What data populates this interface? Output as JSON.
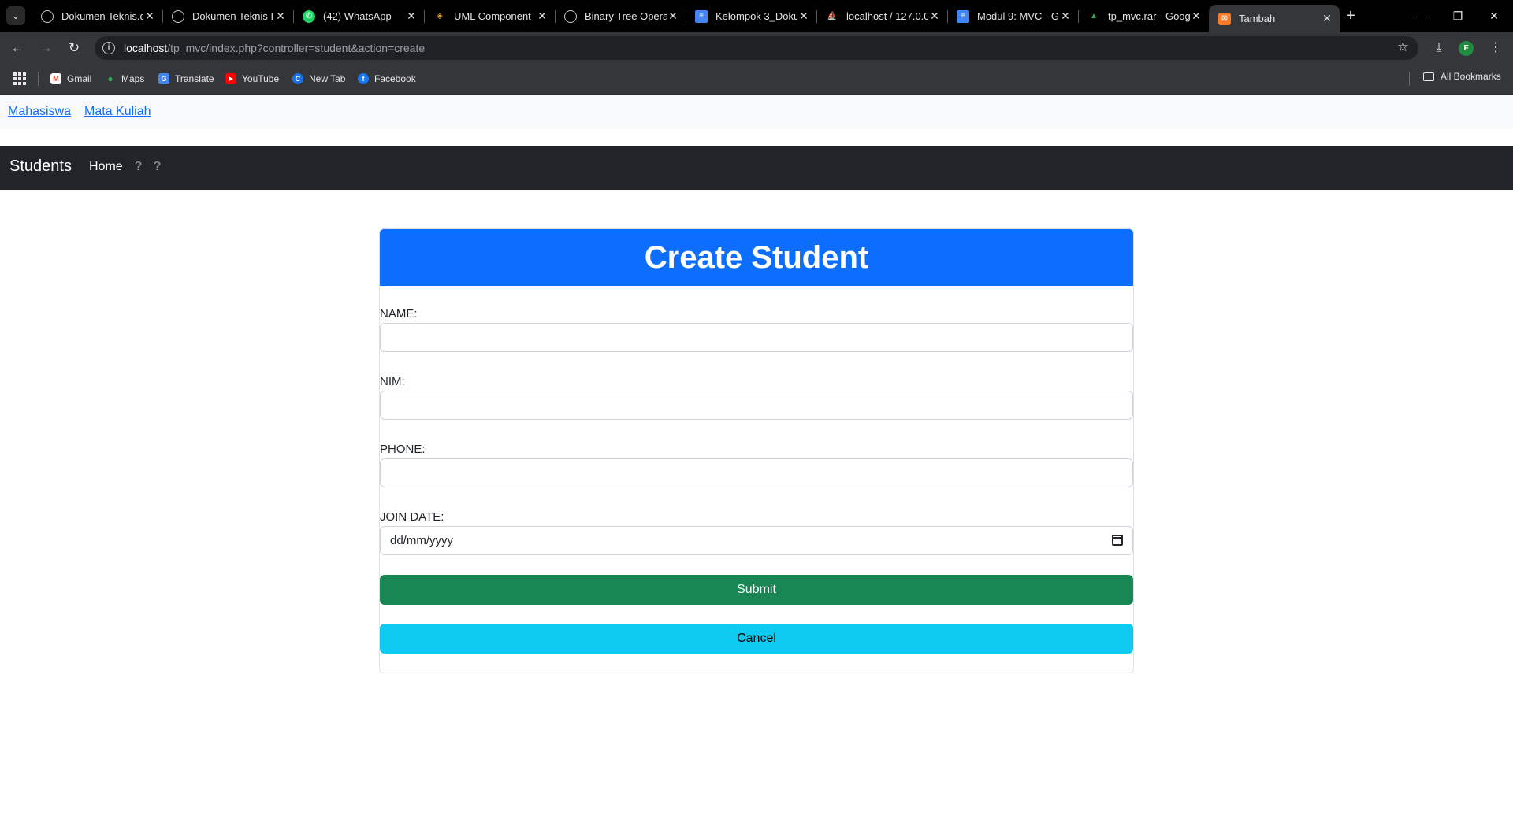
{
  "browser": {
    "tabs": [
      {
        "title": "Dokumen Teknis.d",
        "icon": "globe-icon",
        "color": "#9aa0a6"
      },
      {
        "title": "Dokumen Teknis I",
        "icon": "globe-icon",
        "color": "#9aa0a6"
      },
      {
        "title": "(42) WhatsApp",
        "icon": "whatsapp-icon",
        "color": "#25d366"
      },
      {
        "title": "UML Component",
        "icon": "plantuml-icon",
        "color": "#e0a030"
      },
      {
        "title": "Binary Tree Opera",
        "icon": "github-icon",
        "color": "#c9c9c9"
      },
      {
        "title": "Kelompok 3_Doku",
        "icon": "google-docs-icon",
        "color": "#4285f4"
      },
      {
        "title": "localhost / 127.0.0",
        "icon": "phpmyadmin-icon",
        "color": "#f29111"
      },
      {
        "title": "Modul 9: MVC - G",
        "icon": "google-docs-icon",
        "color": "#4285f4"
      },
      {
        "title": "tp_mvc.rar - Goog",
        "icon": "google-drive-icon",
        "color": "#34a853"
      },
      {
        "title": "Tambah",
        "icon": "xampp-icon",
        "color": "#fb7a24",
        "active": true
      }
    ],
    "url_host": "localhost",
    "url_path": "/tp_mvc/index.php?controller=student&action=create",
    "profile_initial": "F",
    "bookmarks": [
      {
        "label": "Gmail",
        "icon": "gmail-icon",
        "color": "#ea4335"
      },
      {
        "label": "Maps",
        "icon": "maps-icon",
        "color": "#34a853"
      },
      {
        "label": "Translate",
        "icon": "translate-icon",
        "color": "#4285f4"
      },
      {
        "label": "YouTube",
        "icon": "youtube-icon",
        "color": "#ff0000"
      },
      {
        "label": "New Tab",
        "icon": "new-tab-icon",
        "color": "#1a73e8"
      },
      {
        "label": "Facebook",
        "icon": "facebook-icon",
        "color": "#1877f2"
      }
    ],
    "all_bookmarks": "All Bookmarks"
  },
  "page": {
    "top_links": [
      "Mahasiswa",
      "Mata Kuliah"
    ],
    "navbar": {
      "brand": "Students",
      "links": [
        "Home",
        "?",
        "?"
      ]
    },
    "form": {
      "title": "Create Student",
      "fields": [
        {
          "label": "NAME:",
          "value": ""
        },
        {
          "label": "NIM:",
          "value": ""
        },
        {
          "label": "PHONE:",
          "value": ""
        },
        {
          "label": "JOIN DATE:",
          "value": "dd/mm/yyyy"
        }
      ],
      "submit_label": "Submit",
      "cancel_label": "Cancel"
    }
  }
}
